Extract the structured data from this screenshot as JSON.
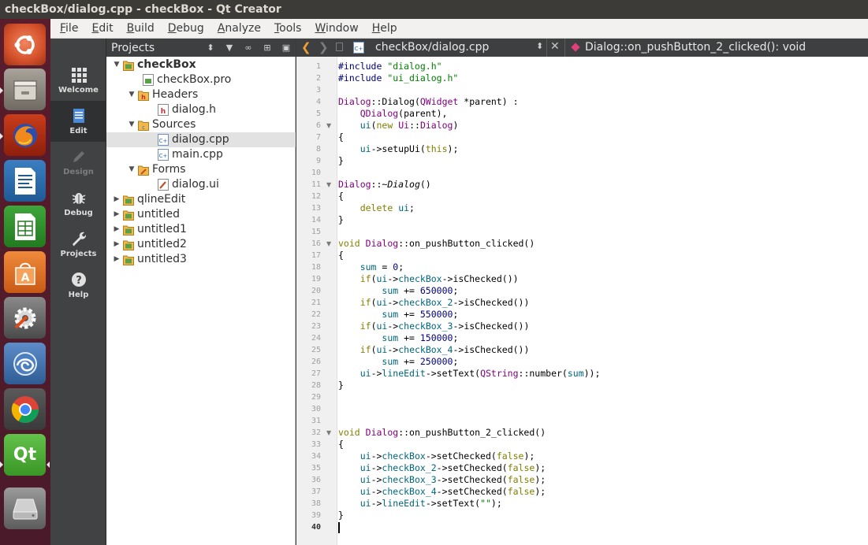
{
  "window": {
    "title": "checkBox/dialog.cpp - checkBox - Qt Creator"
  },
  "launcher": {
    "items": [
      {
        "name": "ubuntu-dash-icon",
        "active": true
      },
      {
        "name": "files-icon",
        "active": true
      },
      {
        "name": "firefox-icon",
        "active": true
      },
      {
        "name": "libreoffice-writer-icon",
        "active": false
      },
      {
        "name": "libreoffice-calc-icon",
        "active": false
      },
      {
        "name": "software-center-icon",
        "active": false
      },
      {
        "name": "system-settings-icon",
        "active": false
      },
      {
        "name": "app-icon",
        "active": false
      },
      {
        "name": "chrome-icon",
        "active": false
      },
      {
        "name": "qt-creator-icon",
        "active": true
      },
      {
        "name": "drive-icon",
        "active": false
      }
    ],
    "qt_label": "Qt"
  },
  "menubar": {
    "items": [
      {
        "label": "File",
        "mnemonic": "F",
        "rest": "ile"
      },
      {
        "label": "Edit",
        "mnemonic": "E",
        "rest": "dit"
      },
      {
        "label": "Build",
        "mnemonic": "B",
        "rest": "uild"
      },
      {
        "label": "Debug",
        "mnemonic": "D",
        "rest": "ebug"
      },
      {
        "label": "Analyze",
        "mnemonic": "A",
        "rest": "nalyze"
      },
      {
        "label": "Tools",
        "mnemonic": "T",
        "rest": "ools"
      },
      {
        "label": "Window",
        "mnemonic": "W",
        "rest": "indow"
      },
      {
        "label": "Help",
        "mnemonic": "H",
        "rest": "elp"
      }
    ]
  },
  "modes": [
    {
      "label": "Welcome",
      "icon": "grid-icon",
      "state": "normal"
    },
    {
      "label": "Edit",
      "icon": "document-icon",
      "state": "active"
    },
    {
      "label": "Design",
      "icon": "pencil-icon",
      "state": "disabled"
    },
    {
      "label": "Debug",
      "icon": "bug-icon",
      "state": "normal"
    },
    {
      "label": "Projects",
      "icon": "wrench-icon",
      "state": "normal"
    },
    {
      "label": "Help",
      "icon": "help-icon",
      "state": "normal"
    }
  ],
  "projects_pane": {
    "title": "Projects",
    "tree": [
      {
        "label": "checkBox",
        "depth": 0,
        "arrow": "open",
        "icon": "project",
        "bold": true
      },
      {
        "label": "checkBox.pro",
        "depth": 1,
        "arrow": "none",
        "icon": "pro"
      },
      {
        "label": "Headers",
        "depth": 1,
        "arrow": "open",
        "icon": "folder-h"
      },
      {
        "label": "dialog.h",
        "depth": 2,
        "arrow": "none",
        "icon": "h"
      },
      {
        "label": "Sources",
        "depth": 1,
        "arrow": "open",
        "icon": "folder-src"
      },
      {
        "label": "dialog.cpp",
        "depth": 2,
        "arrow": "none",
        "icon": "cpp",
        "selected": true
      },
      {
        "label": "main.cpp",
        "depth": 2,
        "arrow": "none",
        "icon": "cpp"
      },
      {
        "label": "Forms",
        "depth": 1,
        "arrow": "open",
        "icon": "folder-ui"
      },
      {
        "label": "dialog.ui",
        "depth": 2,
        "arrow": "none",
        "icon": "ui"
      },
      {
        "label": "qlineEdit",
        "depth": 0,
        "arrow": "closed",
        "icon": "project"
      },
      {
        "label": "untitled",
        "depth": 0,
        "arrow": "closed",
        "icon": "project"
      },
      {
        "label": "untitled1",
        "depth": 0,
        "arrow": "closed",
        "icon": "project"
      },
      {
        "label": "untitled2",
        "depth": 0,
        "arrow": "closed",
        "icon": "project"
      },
      {
        "label": "untitled3",
        "depth": 0,
        "arrow": "closed",
        "icon": "project"
      }
    ]
  },
  "editor_toolbar": {
    "file": "checkBox/dialog.cpp",
    "symbol": "Dialog::on_pushButton_2_clicked(): void"
  },
  "editor": {
    "current_line": 40,
    "lines": [
      {
        "n": "1",
        "t": [
          [
            "pp",
            "#include "
          ],
          [
            "str",
            "\"dialog.h\""
          ]
        ]
      },
      {
        "n": "2",
        "t": [
          [
            "pp",
            "#include "
          ],
          [
            "str",
            "\"ui_dialog.h\""
          ]
        ]
      },
      {
        "n": "3",
        "t": []
      },
      {
        "n": "4",
        "t": [
          [
            "type",
            "Dialog"
          ],
          [
            "def",
            "::"
          ],
          [
            "def",
            "Dialog("
          ],
          [
            "type",
            "QWidget"
          ],
          [
            "def",
            " *parent) :"
          ]
        ]
      },
      {
        "n": "5",
        "t": [
          [
            "def",
            "    "
          ],
          [
            "type",
            "QDialog"
          ],
          [
            "def",
            "(parent),"
          ]
        ]
      },
      {
        "n": "6",
        "fold": true,
        "t": [
          [
            "def",
            "    "
          ],
          [
            "fn",
            "ui"
          ],
          [
            "def",
            "("
          ],
          [
            "kw",
            "new"
          ],
          [
            "def",
            " "
          ],
          [
            "type",
            "Ui"
          ],
          [
            "def",
            "::"
          ],
          [
            "type",
            "Dialog"
          ],
          [
            "def",
            ")"
          ]
        ]
      },
      {
        "n": "7",
        "t": [
          [
            "def",
            "{"
          ]
        ]
      },
      {
        "n": "8",
        "t": [
          [
            "def",
            "    "
          ],
          [
            "fn",
            "ui"
          ],
          [
            "def",
            "->setupUi("
          ],
          [
            "kw",
            "this"
          ],
          [
            "def",
            ");"
          ]
        ]
      },
      {
        "n": "9",
        "t": [
          [
            "def",
            "}"
          ]
        ]
      },
      {
        "n": "10",
        "t": []
      },
      {
        "n": "11",
        "fold": true,
        "t": [
          [
            "type",
            "Dialog"
          ],
          [
            "def",
            "::~"
          ],
          [
            "it",
            "Dialog"
          ],
          [
            "def",
            "()"
          ]
        ]
      },
      {
        "n": "12",
        "t": [
          [
            "def",
            "{"
          ]
        ]
      },
      {
        "n": "13",
        "t": [
          [
            "def",
            "    "
          ],
          [
            "kw",
            "delete"
          ],
          [
            "def",
            " "
          ],
          [
            "fn",
            "ui"
          ],
          [
            "def",
            ";"
          ]
        ]
      },
      {
        "n": "14",
        "t": [
          [
            "def",
            "}"
          ]
        ]
      },
      {
        "n": "15",
        "t": []
      },
      {
        "n": "16",
        "fold": true,
        "t": [
          [
            "kw",
            "void"
          ],
          [
            "def",
            " "
          ],
          [
            "type",
            "Dialog"
          ],
          [
            "def",
            "::on_pushButton_clicked()"
          ]
        ]
      },
      {
        "n": "17",
        "t": [
          [
            "def",
            "{"
          ]
        ]
      },
      {
        "n": "18",
        "t": [
          [
            "def",
            "    "
          ],
          [
            "fn",
            "sum"
          ],
          [
            "def",
            " = "
          ],
          [
            "num",
            "0"
          ],
          [
            "def",
            ";"
          ]
        ]
      },
      {
        "n": "19",
        "t": [
          [
            "def",
            "    "
          ],
          [
            "kw",
            "if"
          ],
          [
            "def",
            "("
          ],
          [
            "fn",
            "ui"
          ],
          [
            "def",
            "->"
          ],
          [
            "fn",
            "checkBox"
          ],
          [
            "def",
            "->isChecked())"
          ]
        ]
      },
      {
        "n": "20",
        "t": [
          [
            "def",
            "        "
          ],
          [
            "fn",
            "sum"
          ],
          [
            "def",
            " += "
          ],
          [
            "num",
            "650000"
          ],
          [
            "def",
            ";"
          ]
        ]
      },
      {
        "n": "21",
        "t": [
          [
            "def",
            "    "
          ],
          [
            "kw",
            "if"
          ],
          [
            "def",
            "("
          ],
          [
            "fn",
            "ui"
          ],
          [
            "def",
            "->"
          ],
          [
            "fn",
            "checkBox_2"
          ],
          [
            "def",
            "->isChecked())"
          ]
        ]
      },
      {
        "n": "22",
        "t": [
          [
            "def",
            "        "
          ],
          [
            "fn",
            "sum"
          ],
          [
            "def",
            " += "
          ],
          [
            "num",
            "550000"
          ],
          [
            "def",
            ";"
          ]
        ]
      },
      {
        "n": "23",
        "t": [
          [
            "def",
            "    "
          ],
          [
            "kw",
            "if"
          ],
          [
            "def",
            "("
          ],
          [
            "fn",
            "ui"
          ],
          [
            "def",
            "->"
          ],
          [
            "fn",
            "checkBox_3"
          ],
          [
            "def",
            "->isChecked())"
          ]
        ]
      },
      {
        "n": "24",
        "t": [
          [
            "def",
            "        "
          ],
          [
            "fn",
            "sum"
          ],
          [
            "def",
            " += "
          ],
          [
            "num",
            "150000"
          ],
          [
            "def",
            ";"
          ]
        ]
      },
      {
        "n": "25",
        "t": [
          [
            "def",
            "    "
          ],
          [
            "kw",
            "if"
          ],
          [
            "def",
            "("
          ],
          [
            "fn",
            "ui"
          ],
          [
            "def",
            "->"
          ],
          [
            "fn",
            "checkBox_4"
          ],
          [
            "def",
            "->isChecked())"
          ]
        ]
      },
      {
        "n": "26",
        "t": [
          [
            "def",
            "        "
          ],
          [
            "fn",
            "sum"
          ],
          [
            "def",
            " += "
          ],
          [
            "num",
            "250000"
          ],
          [
            "def",
            ";"
          ]
        ]
      },
      {
        "n": "27",
        "t": [
          [
            "def",
            "    "
          ],
          [
            "fn",
            "ui"
          ],
          [
            "def",
            "->"
          ],
          [
            "fn",
            "lineEdit"
          ],
          [
            "def",
            "->setText("
          ],
          [
            "type",
            "QString"
          ],
          [
            "def",
            "::number("
          ],
          [
            "fn",
            "sum"
          ],
          [
            "def",
            "));"
          ]
        ]
      },
      {
        "n": "28",
        "t": [
          [
            "def",
            "}"
          ]
        ]
      },
      {
        "n": "29",
        "t": []
      },
      {
        "n": "30",
        "t": []
      },
      {
        "n": "31",
        "t": []
      },
      {
        "n": "32",
        "fold": true,
        "t": [
          [
            "kw",
            "void"
          ],
          [
            "def",
            " "
          ],
          [
            "type",
            "Dialog"
          ],
          [
            "def",
            "::on_pushButton_2_clicked()"
          ]
        ]
      },
      {
        "n": "33",
        "t": [
          [
            "def",
            "{"
          ]
        ]
      },
      {
        "n": "34",
        "t": [
          [
            "def",
            "    "
          ],
          [
            "fn",
            "ui"
          ],
          [
            "def",
            "->"
          ],
          [
            "fn",
            "checkBox"
          ],
          [
            "def",
            "->setChecked("
          ],
          [
            "kw",
            "false"
          ],
          [
            "def",
            ");"
          ]
        ]
      },
      {
        "n": "35",
        "t": [
          [
            "def",
            "    "
          ],
          [
            "fn",
            "ui"
          ],
          [
            "def",
            "->"
          ],
          [
            "fn",
            "checkBox_2"
          ],
          [
            "def",
            "->setChecked("
          ],
          [
            "kw",
            "false"
          ],
          [
            "def",
            ");"
          ]
        ]
      },
      {
        "n": "36",
        "t": [
          [
            "def",
            "    "
          ],
          [
            "fn",
            "ui"
          ],
          [
            "def",
            "->"
          ],
          [
            "fn",
            "checkBox_3"
          ],
          [
            "def",
            "->setChecked("
          ],
          [
            "kw",
            "false"
          ],
          [
            "def",
            ");"
          ]
        ]
      },
      {
        "n": "37",
        "t": [
          [
            "def",
            "    "
          ],
          [
            "fn",
            "ui"
          ],
          [
            "def",
            "->"
          ],
          [
            "fn",
            "checkBox_4"
          ],
          [
            "def",
            "->setChecked("
          ],
          [
            "kw",
            "false"
          ],
          [
            "def",
            ");"
          ]
        ]
      },
      {
        "n": "38",
        "t": [
          [
            "def",
            "    "
          ],
          [
            "fn",
            "ui"
          ],
          [
            "def",
            "->"
          ],
          [
            "fn",
            "lineEdit"
          ],
          [
            "def",
            "->setText("
          ],
          [
            "str",
            "\"\""
          ],
          [
            "def",
            ");"
          ]
        ]
      },
      {
        "n": "39",
        "t": [
          [
            "def",
            "}"
          ]
        ]
      },
      {
        "n": "40",
        "t": [],
        "cursor": true
      }
    ]
  },
  "colors": {
    "launcher_bg": "#4f1c2c",
    "modebar_bg": "#404244",
    "keyword": "#808000",
    "string": "#008000",
    "type": "#800080",
    "member": "#00677c",
    "number": "#000080"
  }
}
